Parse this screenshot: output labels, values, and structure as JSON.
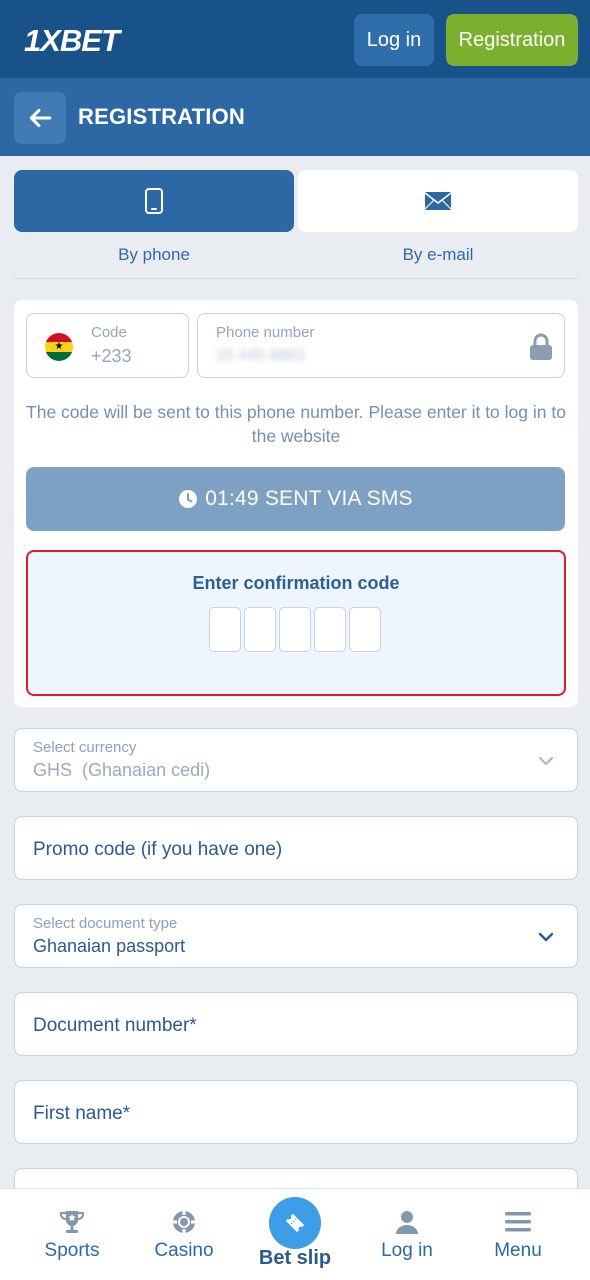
{
  "header": {
    "logo": "1XBET",
    "login_label": "Log in",
    "registration_label": "Registration"
  },
  "subheader": {
    "title": "REGISTRATION",
    "back_icon": "arrow-left-icon"
  },
  "tabs": [
    {
      "label": "By phone",
      "icon": "smartphone-icon",
      "active": true
    },
    {
      "label": "By e-mail",
      "icon": "envelope-icon",
      "active": false
    }
  ],
  "phone_form": {
    "code_label": "Code",
    "code_value": "+233",
    "flag": "ghana-flag-icon",
    "phone_label": "Phone number",
    "phone_value": "20 445 8883",
    "helper_text": "The code will be sent to this phone number. Please enter it to log in to the website",
    "sms_button_label": "01:49 SENT VIA SMS",
    "confirm_title": "Enter confirmation code",
    "digit_count": 5
  },
  "fields": {
    "currency": {
      "label": "Select currency",
      "code": "GHS",
      "name": "(Ghanaian cedi)"
    },
    "promo": {
      "placeholder": "Promo code (if you have one)"
    },
    "document_type": {
      "label": "Select document type",
      "value": "Ghanaian passport"
    },
    "document_number": {
      "placeholder": "Document number*"
    },
    "first_name": {
      "placeholder": "First name*"
    }
  },
  "bottom_nav": [
    {
      "label": "Sports",
      "icon": "trophy-icon"
    },
    {
      "label": "Casino",
      "icon": "casino-chip-icon"
    },
    {
      "label": "Bet slip",
      "icon": "ticket-icon"
    },
    {
      "label": "Log in",
      "icon": "user-icon"
    },
    {
      "label": "Menu",
      "icon": "menu-icon"
    }
  ],
  "colors": {
    "header_bg": "#195288",
    "subheader_bg": "#2b68a4",
    "registration_green": "#7bb02f",
    "accent_blue": "#3c9ee6",
    "error_red": "#d91c26"
  }
}
